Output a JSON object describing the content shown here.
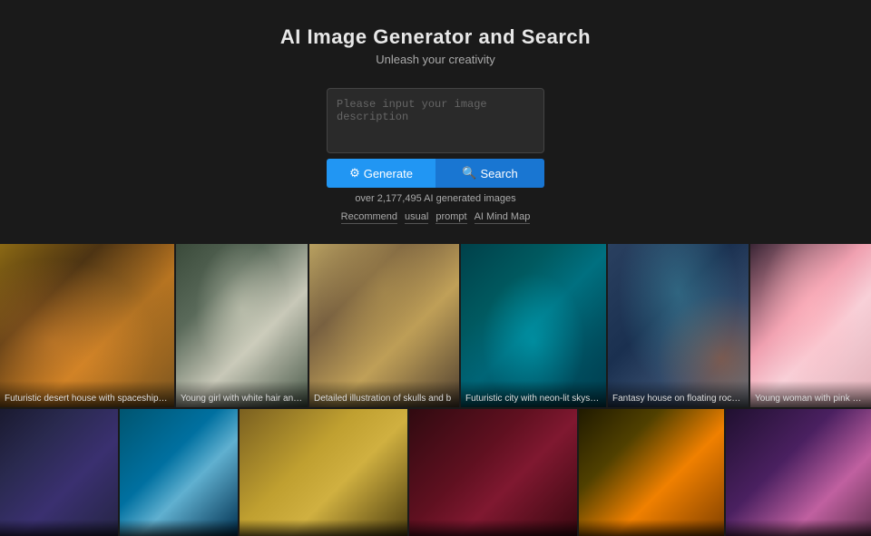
{
  "header": {
    "title": "AI Image Generator and Search",
    "subtitle": "Unleash your creativity"
  },
  "search": {
    "placeholder": "Please input your image description",
    "generate_label": "Generate",
    "search_label": "Search",
    "generate_icon": "⚙",
    "search_icon": "🔍",
    "stats": "over 2,177,495 AI generated images"
  },
  "tags": [
    {
      "label": "Recommend"
    },
    {
      "label": "usual"
    },
    {
      "label": "prompt"
    },
    {
      "label": "AI Mind Map"
    }
  ],
  "gallery_row1": [
    {
      "caption": "Futuristic desert house with spaceships, trees, r"
    },
    {
      "caption": "Young girl with white hair and gold"
    },
    {
      "caption": "Detailed illustration of skulls and b"
    },
    {
      "caption": "Futuristic city with neon-lit skyscra"
    },
    {
      "caption": "Fantasy house on floating rock wit"
    },
    {
      "caption": "Young woman with pink hair and eyes, sitting in"
    }
  ],
  "gallery_row2": [
    {
      "caption": ""
    },
    {
      "caption": ""
    },
    {
      "caption": ""
    },
    {
      "caption": ""
    },
    {
      "caption": ""
    },
    {
      "caption": ""
    }
  ]
}
